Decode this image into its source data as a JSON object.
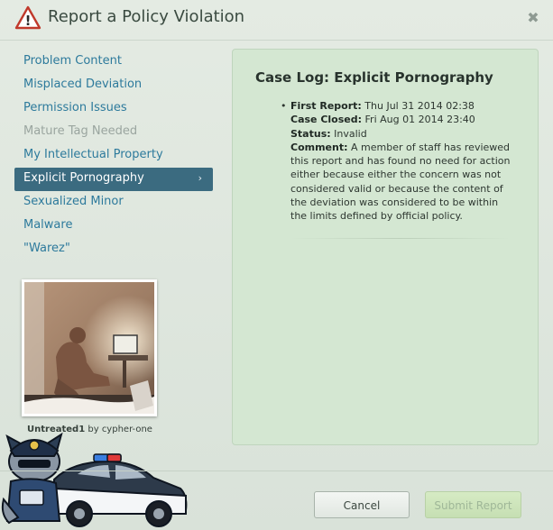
{
  "dialog": {
    "title": "Report a Policy Violation",
    "close_glyph": "✖",
    "warn_glyph": "!"
  },
  "nav": {
    "items": [
      {
        "label": "Problem Content",
        "state": "normal"
      },
      {
        "label": "Misplaced Deviation",
        "state": "normal"
      },
      {
        "label": "Permission Issues",
        "state": "normal"
      },
      {
        "label": "Mature Tag Needed",
        "state": "disabled"
      },
      {
        "label": "My Intellectual Property",
        "state": "normal"
      },
      {
        "label": "Explicit Pornography",
        "state": "active"
      },
      {
        "label": "Sexualized Minor",
        "state": "normal"
      },
      {
        "label": "Malware",
        "state": "normal"
      },
      {
        "label": "\"Warez\"",
        "state": "normal"
      }
    ],
    "chevron_glyph": "›"
  },
  "thumbnail": {
    "title": "Untreated1",
    "by": "by",
    "author": "cypher-one"
  },
  "case_log": {
    "title": "Case Log: Explicit Pornography",
    "first_report_label": "First Report:",
    "first_report_value": "Thu Jul 31 2014 02:38",
    "case_closed_label": "Case Closed:",
    "case_closed_value": "Fri Aug 01 2014 23:40",
    "status_label": "Status:",
    "status_value": "Invalid",
    "comment_label": "Comment:",
    "comment_value": "A member of staff has reviewed this report and has found no need for action either because either the concern was not considered valid or because the content of the deviation was considered to be within the limits defined by official policy."
  },
  "footer": {
    "cancel_label": "Cancel",
    "submit_label": "Submit Report"
  },
  "colors": {
    "link": "#2d7a9c",
    "active_bg": "#3b6b80",
    "panel_bg": "#d4e7d2",
    "warn": "#c0392b"
  }
}
